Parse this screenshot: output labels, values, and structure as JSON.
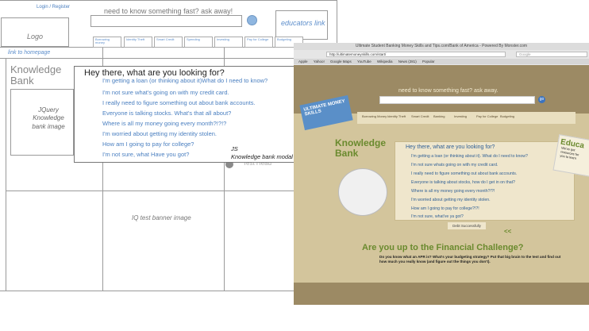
{
  "wireframe": {
    "login_register": "Login / Register",
    "search_placeholder": "need to know something fast? ask away!",
    "educators_link": "educators link",
    "logo_label": "Logo",
    "homepage_link": "link to homepage",
    "nav_tabs": [
      "Borrowing money",
      "Identity Theft",
      "Smart Credit",
      "Spending",
      "Investing",
      "Pay for College",
      "Budgeting"
    ],
    "knowledge_bank_title": "Knowledge Bank",
    "jquery_label": "JQuery Knowledge bank image",
    "iq_banner": "IQ test banner image",
    "modal": {
      "title": "Hey there, what are you looking for?",
      "items": [
        "I'm getting a loan (or thinking about it)What do I need to know?",
        "I'm not sure what's going on with my credit card.",
        "I really need to figure something out about bank accounts.",
        "Everyone is talking stocks. What's that all about?",
        "Where is all my money going every month?!?!?",
        "I'm worried about getting my identity stolen.",
        "How am I going to pay for college?",
        "I'm not sure, what Have you got?"
      ],
      "note_line1": "JS",
      "note_line2": "Knowledge bank modal menu"
    },
    "faded_label": "Test Head"
  },
  "browser": {
    "window_title": "Ultimate Student Banking Money Skills and Tips.com/Bank of America - Powered By Monster.com",
    "url": "http://ultimatemoneyskills.com/start/",
    "search_engine": "Google",
    "bookmarks": [
      "Apple",
      "Yahoo!",
      "Google Maps",
      "YouTube",
      "Wikipedia",
      "News (281)",
      "Popular"
    ],
    "search_prompt": "need to know something fast? ask away.",
    "go_label": "go",
    "badge": "ULTIMATE MONEY SKILLS",
    "nav": [
      "Borrowing Money",
      "Identity Theft",
      "Smart Credit",
      "Banking",
      "Investing",
      "Pay for College",
      "Budgeting"
    ],
    "kb_title": "Knowledge Bank",
    "modal_title": "Hey there, what are you looking for?",
    "modal_items": [
      "I'm getting a loan (or thinking about it). What do I need to know?",
      "I'm not sure whats going on with my credit card.",
      "I really need to figure something out about bank accounts.",
      "Everyone is talking about stocks, how do I get in on that?",
      "Where is all my money going every month?!?!",
      "I'm worried about getting my identity stolen.",
      "How am I going to pay for college?!?!",
      "I'm not sure, what've ya got?"
    ],
    "strip_text": "Debt Successfully",
    "arrows": "<<",
    "challenge_title": "Are you up to the Financial Challenge?",
    "challenge_desc": "Do you know what an APR is? What's your budgeting strategy? Put that big brain to the test and find out how much you really know (and figure out the things you don't).",
    "educators_title": "Educa",
    "educators_sub": "We've got resources for you to learn"
  }
}
